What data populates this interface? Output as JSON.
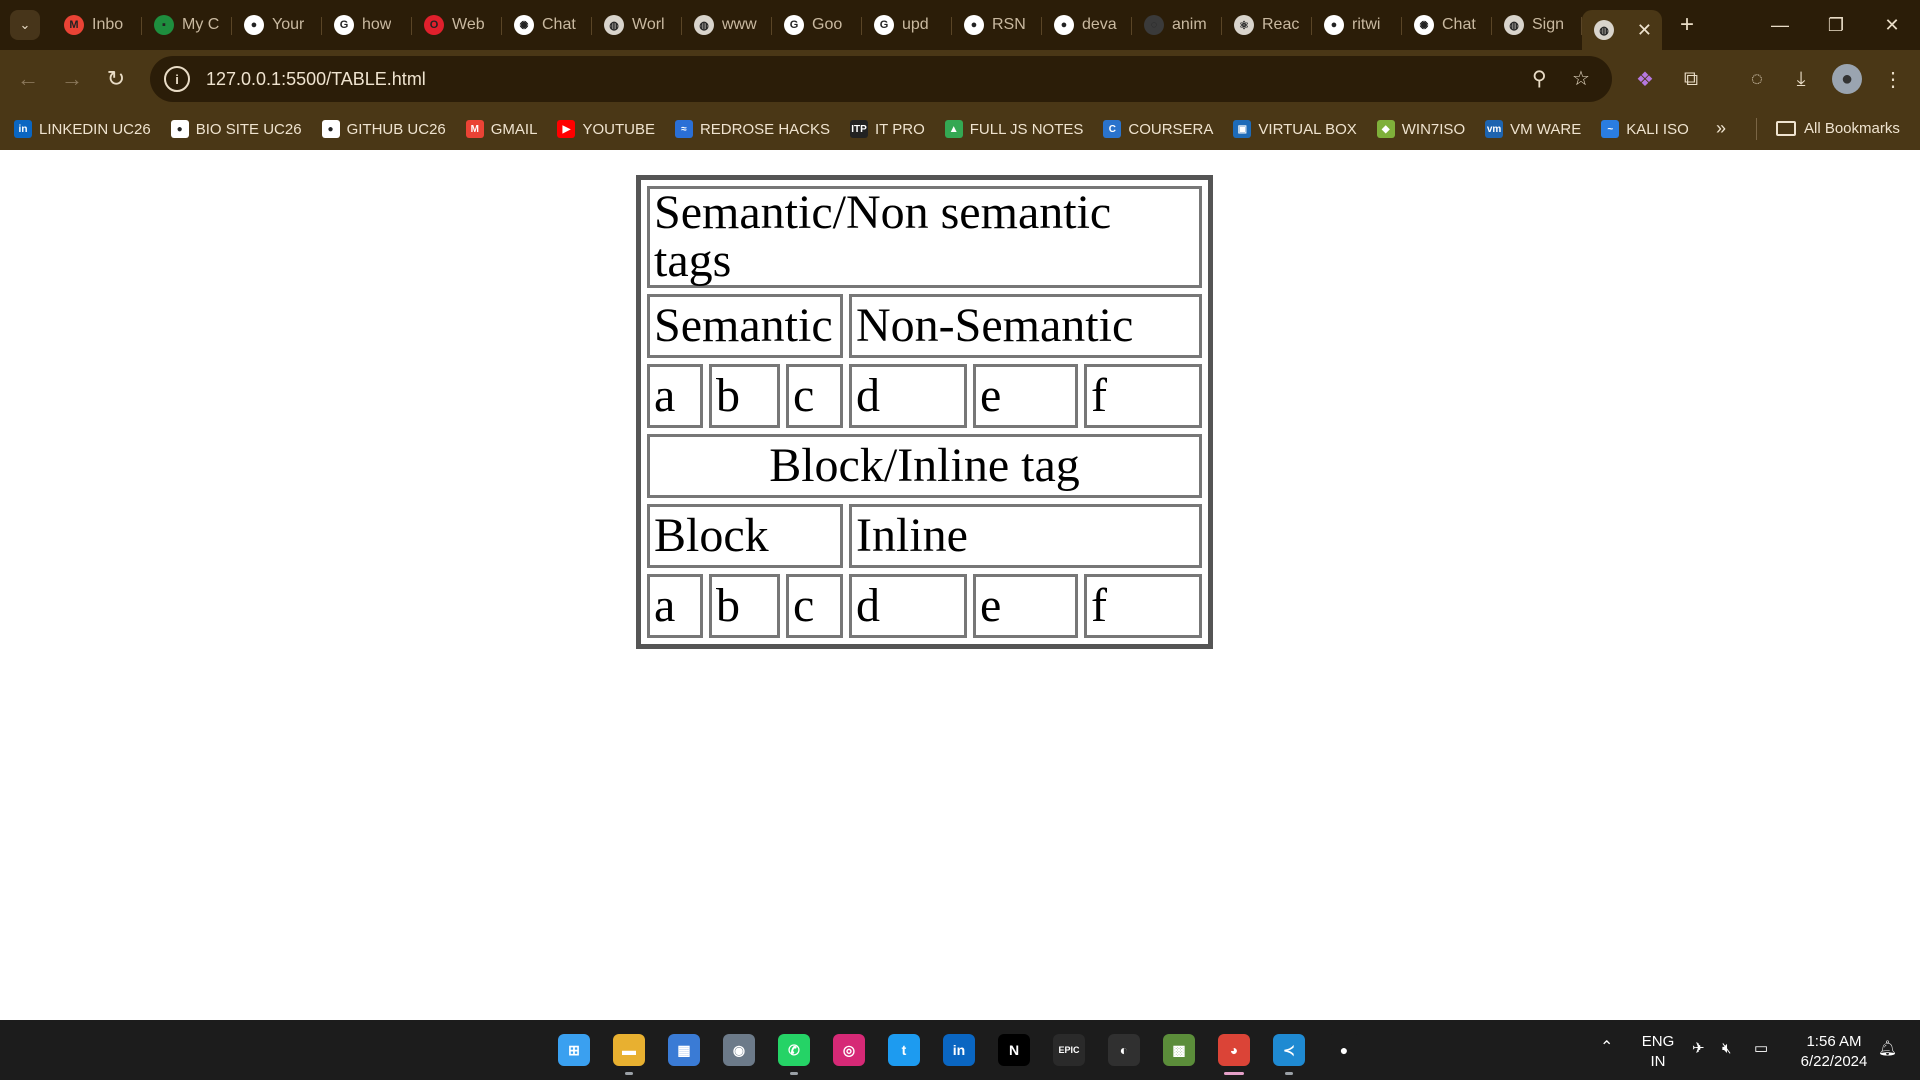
{
  "tabs": [
    {
      "title": "Inbo",
      "icon": "gmail-icon",
      "color": "#ea4335",
      "glyph": "M"
    },
    {
      "title": "My C",
      "icon": "classroom-icon",
      "color": "#1e8e3e",
      "glyph": "▪"
    },
    {
      "title": "Your",
      "icon": "github-icon",
      "color": "#ffffff",
      "glyph": "●"
    },
    {
      "title": "how",
      "icon": "google-icon",
      "color": "#ffffff",
      "glyph": "G"
    },
    {
      "title": "Web",
      "icon": "opera-icon",
      "color": "#e0202c",
      "glyph": "O"
    },
    {
      "title": "Chat",
      "icon": "chatgpt-icon",
      "color": "#ffffff",
      "glyph": "✺"
    },
    {
      "title": "Worl",
      "icon": "globe-icon",
      "color": "#d9d4cc",
      "glyph": "◍"
    },
    {
      "title": "www",
      "icon": "globe-icon",
      "color": "#d9d4cc",
      "glyph": "◍"
    },
    {
      "title": "Goo",
      "icon": "google-icon",
      "color": "#ffffff",
      "glyph": "G"
    },
    {
      "title": "upd",
      "icon": "google-icon",
      "color": "#ffffff",
      "glyph": "G"
    },
    {
      "title": "RSN",
      "icon": "github-icon",
      "color": "#ffffff",
      "glyph": "●"
    },
    {
      "title": "deva",
      "icon": "github-icon",
      "color": "#ffffff",
      "glyph": "●"
    },
    {
      "title": "anim",
      "icon": "spinner-icon",
      "color": "#3a3a3a",
      "glyph": "◌"
    },
    {
      "title": "Reac",
      "icon": "react-icon",
      "color": "#d9d4cc",
      "glyph": "⚛"
    },
    {
      "title": "ritwi",
      "icon": "github-icon",
      "color": "#ffffff",
      "glyph": "●"
    },
    {
      "title": "Chat",
      "icon": "chatgpt-icon",
      "color": "#ffffff",
      "glyph": "✺"
    },
    {
      "title": "Sign",
      "icon": "globe-icon",
      "color": "#d9d4cc",
      "glyph": "◍"
    }
  ],
  "address_bar": {
    "url": "127.0.0.1:5500/TABLE.html"
  },
  "bookmarks": [
    {
      "label": "LINKEDIN UC26",
      "icon": "linkedin-icon",
      "color": "#0a66c2",
      "glyph": "in"
    },
    {
      "label": "BIO SITE UC26",
      "icon": "biosite-icon",
      "color": "#ffffff",
      "glyph": "●"
    },
    {
      "label": "GITHUB UC26",
      "icon": "github-icon",
      "color": "#ffffff",
      "glyph": "●"
    },
    {
      "label": "GMAIL",
      "icon": "gmail-icon",
      "color": "#ea4335",
      "glyph": "M"
    },
    {
      "label": "YOUTUBE",
      "icon": "youtube-icon",
      "color": "#ff0000",
      "glyph": "▶"
    },
    {
      "label": "REDROSE HACKS",
      "icon": "redrose-icon",
      "color": "#2a6fd6",
      "glyph": "≈"
    },
    {
      "label": "IT PRO",
      "icon": "itpro-icon",
      "color": "#222222",
      "glyph": "ITP"
    },
    {
      "label": "FULL JS NOTES",
      "icon": "drive-icon",
      "color": "#34a853",
      "glyph": "▲"
    },
    {
      "label": "COURSERA",
      "icon": "coursera-icon",
      "color": "#2a73cc",
      "glyph": "C"
    },
    {
      "label": "VIRTUAL BOX",
      "icon": "virtualbox-icon",
      "color": "#1e6bb8",
      "glyph": "▣"
    },
    {
      "label": "WIN7ISO",
      "icon": "win7iso-icon",
      "color": "#7fb03a",
      "glyph": "◆"
    },
    {
      "label": "VM WARE",
      "icon": "vmware-icon",
      "color": "#1d64b0",
      "glyph": "vm"
    },
    {
      "label": "KALI ISO",
      "icon": "kali-icon",
      "color": "#2a7de1",
      "glyph": "~"
    }
  ],
  "bookmarks_more": "»",
  "all_bookmarks": "All Bookmarks",
  "table": {
    "title": "Semantic/Non semantic tags",
    "semantic": "Semantic",
    "non_semantic": "Non-Semantic",
    "row1": [
      "a",
      "b",
      "c",
      "d",
      "e",
      "f"
    ],
    "block_inline_title": "Block/Inline tag",
    "block": "Block",
    "inline": "Inline",
    "row2": [
      "a",
      "b",
      "c",
      "d",
      "e",
      "f"
    ]
  },
  "taskbar": {
    "apps": [
      {
        "name": "windows-start-icon",
        "color": "#3aa0f0",
        "glyph": "⊞"
      },
      {
        "name": "file-explorer-icon",
        "color": "#e8b030",
        "glyph": "▬"
      },
      {
        "name": "microsoft-store-icon",
        "color": "#3a7bd5",
        "glyph": "▦"
      },
      {
        "name": "camera-icon",
        "color": "#6c7a89",
        "glyph": "◉"
      },
      {
        "name": "whatsapp-icon",
        "color": "#25d366",
        "glyph": "✆"
      },
      {
        "name": "instagram-icon",
        "color": "#d62976",
        "glyph": "◎"
      },
      {
        "name": "twitter-icon",
        "color": "#1d9bf0",
        "glyph": "t"
      },
      {
        "name": "linkedin-icon",
        "color": "#0a66c2",
        "glyph": "in"
      },
      {
        "name": "netflix-icon",
        "color": "#000000",
        "glyph": "N"
      },
      {
        "name": "epic-games-icon",
        "color": "#2a2a2a",
        "glyph": "EPIC"
      },
      {
        "name": "obs-icon",
        "color": "#303030",
        "glyph": "◐"
      },
      {
        "name": "minecraft-icon",
        "color": "#5b8d3a",
        "glyph": "▩"
      },
      {
        "name": "chrome-icon",
        "color": "#db4437",
        "glyph": "◕"
      },
      {
        "name": "vscode-icon",
        "color": "#1f8ad2",
        "glyph": "≺"
      },
      {
        "name": "github-desktop-icon",
        "color": "#1c1c1c",
        "glyph": "●"
      }
    ],
    "language": "ENG",
    "region": "IN",
    "time": "1:56 AM",
    "date": "6/22/2024"
  },
  "colors": {
    "chrome_frame": "#2b1d08",
    "toolbar": "#4a3716",
    "table_border": "#555555",
    "cell_border": "#777777",
    "taskbar": "#1c1c1c"
  }
}
